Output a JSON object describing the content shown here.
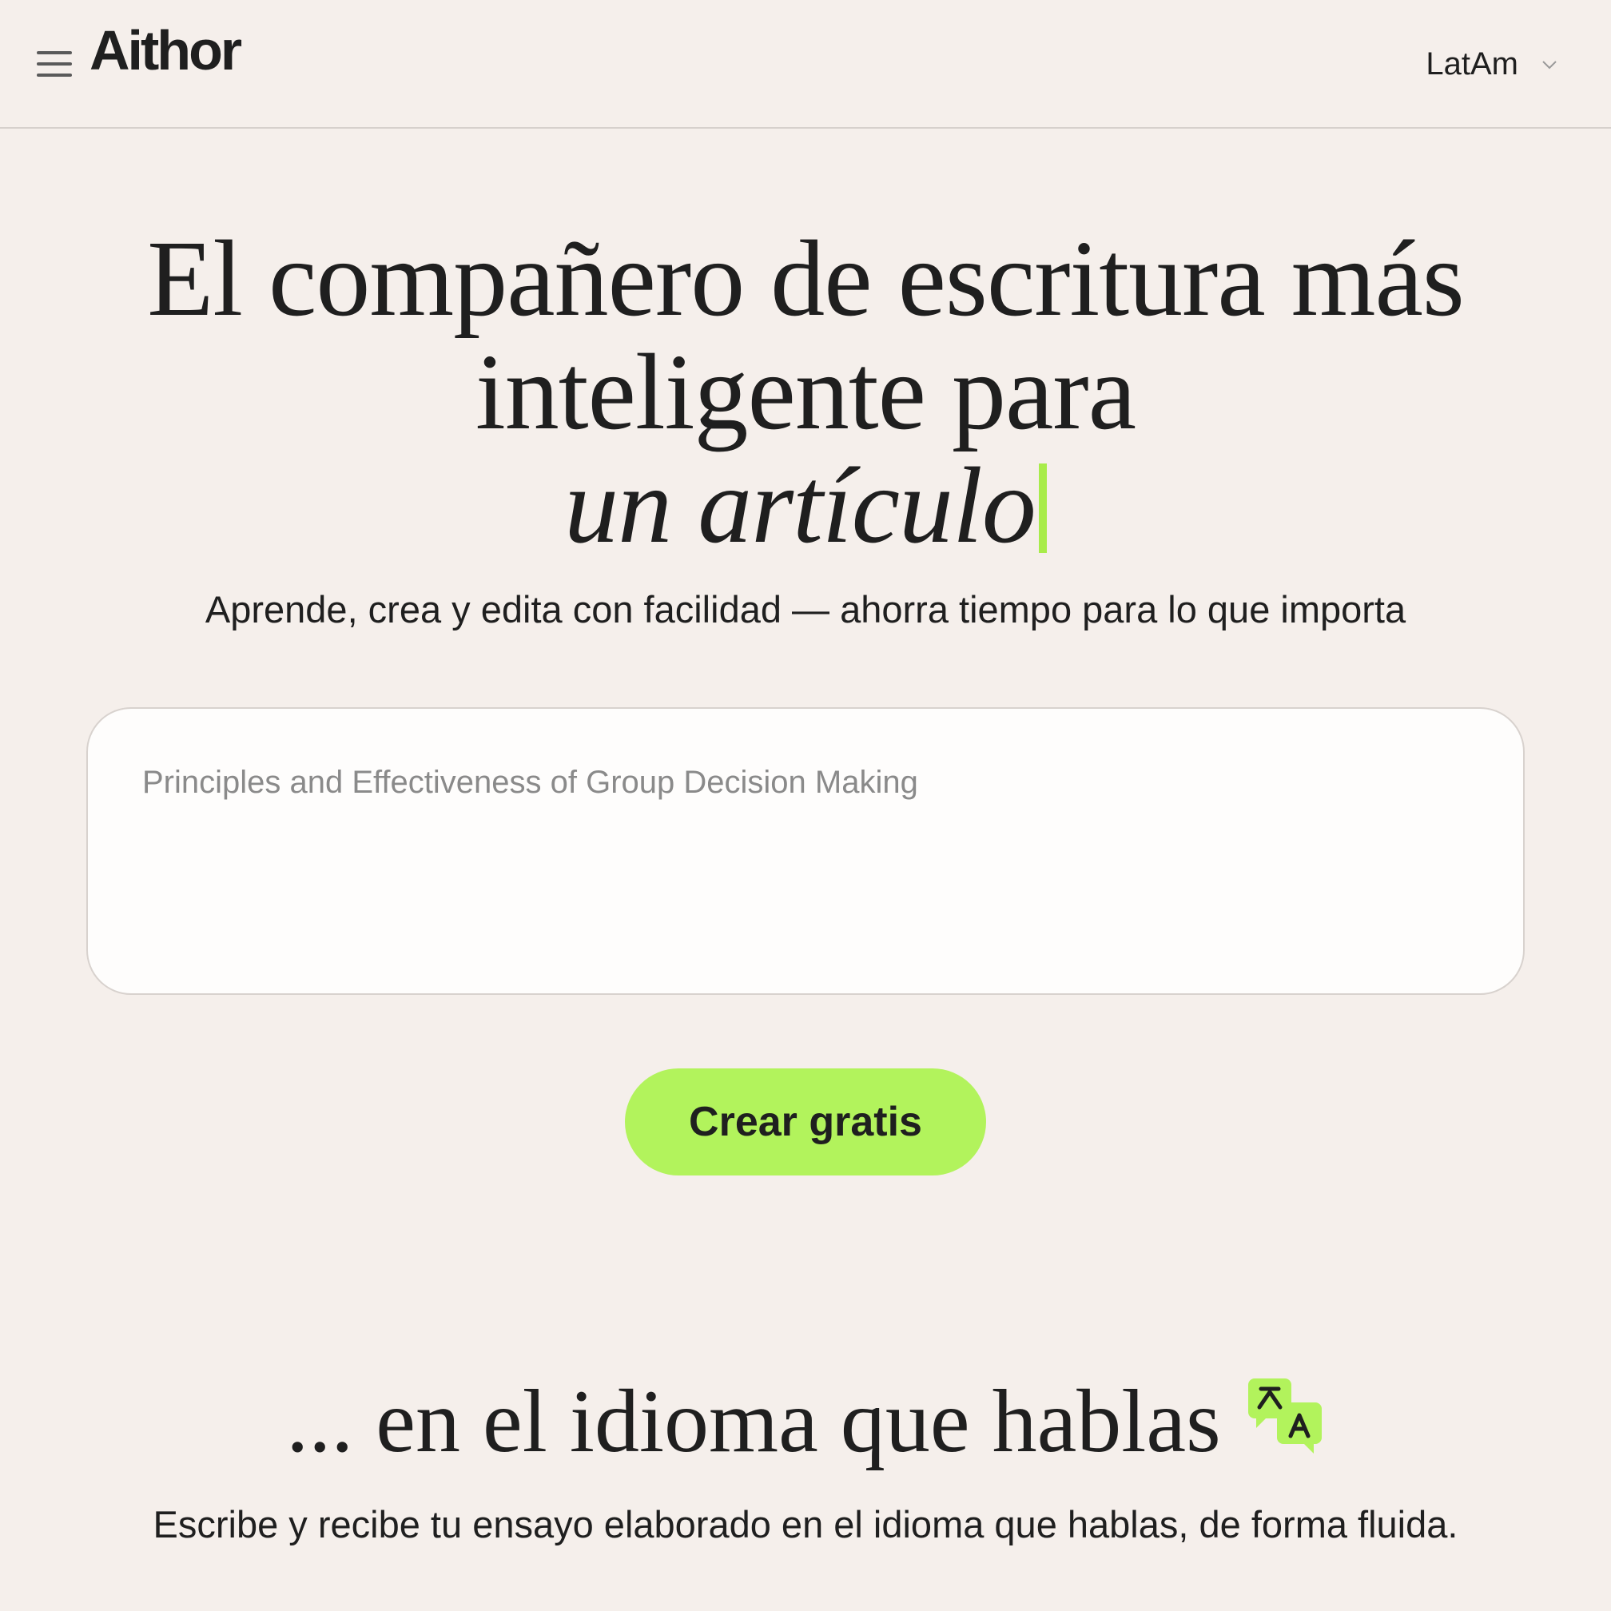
{
  "header": {
    "logo": "Aithor",
    "region": "LatAm",
    "menu_icon": "hamburger-menu-icon",
    "region_icon": "chevron-down-icon"
  },
  "hero": {
    "title_line1": "El compañero de escritura más",
    "title_line2": "inteligente para",
    "title_line3": "un artículo",
    "subtitle": "Aprende, crea y edita con facilidad — ahorra tiempo para lo que importa"
  },
  "prompt": {
    "placeholder": "Principles and Effectiveness of Group Decision Making",
    "value": ""
  },
  "cta": {
    "label": "Crear gratis"
  },
  "language_section": {
    "title": "... en el idioma que hablas",
    "icon": "translate-icon",
    "description": "Escribe y recibe tu ensayo elaborado en el idioma que hablas, de forma fluida."
  },
  "colors": {
    "background": "#f5efeb",
    "accent": "#b2f35c",
    "text": "#1f1f1f",
    "placeholder": "#8a8a8a"
  }
}
